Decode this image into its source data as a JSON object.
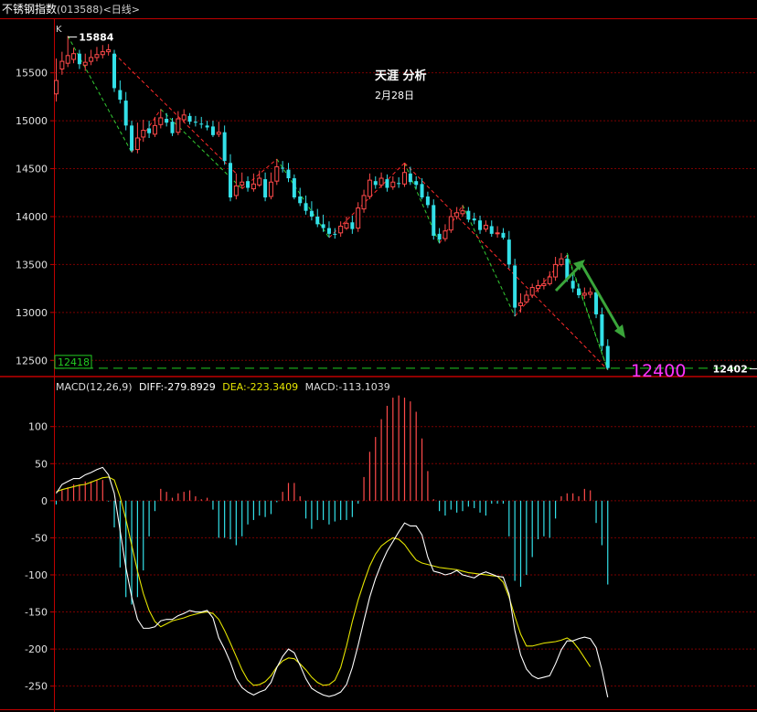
{
  "window": {
    "title": "不锈钢指数",
    "code": "(013588)",
    "period": "<日线>"
  },
  "colors": {
    "up": "#ff4a4a",
    "down": "#33e0e8",
    "grid": "#7a0000",
    "frame": "#c00000",
    "diff": "#ffffff",
    "dea": "#e5e500",
    "zig_green": "#33cc33",
    "zig_red": "#ff2b2b",
    "support": "#22cc22",
    "target_text": "#ff33ff",
    "arrow": "#3aa53a"
  },
  "chart_data": [
    {
      "type": "candlestick",
      "panel_label": "K",
      "title": "天涯 分析",
      "subtitle": "2月28日",
      "ylim": [
        12350,
        16050
      ],
      "yticks": [
        12500,
        13000,
        13500,
        14000,
        14500,
        15000,
        15500
      ],
      "grid": true,
      "high_marker": {
        "label": "15884",
        "index": 2,
        "value": 15884
      },
      "low_marker": {
        "label": "12402",
        "index": 121,
        "value": 12402
      },
      "support_line": {
        "value": 12418,
        "label": "12418"
      },
      "target_annotation": {
        "text": "12400",
        "value": 12400
      },
      "closes": [
        15420,
        15620,
        15680,
        15700,
        15590,
        15610,
        15660,
        15690,
        15720,
        15740,
        15340,
        15220,
        14950,
        14690,
        14820,
        14900,
        14870,
        14950,
        15030,
        14980,
        14870,
        15020,
        15060,
        14990,
        14980,
        14960,
        14930,
        14850,
        14880,
        14580,
        14200,
        14320,
        14360,
        14300,
        14340,
        14400,
        14200,
        14360,
        14520,
        14500,
        14400,
        14200,
        14140,
        14060,
        14000,
        13920,
        13880,
        13820,
        13810,
        13900,
        13930,
        13870,
        14090,
        14220,
        14380,
        14330,
        14400,
        14300,
        14360,
        14340,
        14460,
        14360,
        14330,
        14200,
        14120,
        13800,
        13760,
        13850,
        14000,
        14040,
        14060,
        13970,
        13960,
        13860,
        13910,
        13820,
        13830,
        13780,
        13500,
        13050,
        13100,
        13180,
        13260,
        13280,
        13300,
        13370,
        13500,
        13560,
        13350,
        13250,
        13180,
        13200,
        13210,
        12980,
        12650,
        12420
      ],
      "opens": [
        15280,
        15540,
        15600,
        15640,
        15700,
        15580,
        15620,
        15660,
        15690,
        15720,
        15700,
        15320,
        15210,
        14950,
        14700,
        14830,
        14920,
        14860,
        14960,
        15020,
        14990,
        14880,
        15010,
        15050,
        14990,
        14970,
        14950,
        14940,
        14860,
        14880,
        14560,
        14220,
        14330,
        14370,
        14290,
        14330,
        14390,
        14210,
        14370,
        14510,
        14490,
        14400,
        14210,
        14140,
        14060,
        14000,
        13920,
        13880,
        13820,
        13830,
        13880,
        13940,
        13880,
        14080,
        14210,
        14370,
        14330,
        14390,
        14310,
        14350,
        14340,
        14450,
        14370,
        14340,
        14210,
        14120,
        13820,
        13770,
        13860,
        14000,
        14030,
        14060,
        13980,
        13960,
        13870,
        13900,
        13830,
        13830,
        13760,
        13490,
        13070,
        13110,
        13180,
        13250,
        13280,
        13300,
        13370,
        13500,
        13560,
        13330,
        13250,
        13180,
        13190,
        13210,
        12980,
        12650
      ],
      "highs": [
        15650,
        15720,
        15884,
        15760,
        15740,
        15700,
        15740,
        15770,
        15790,
        15800,
        15740,
        15420,
        15300,
        15000,
        14980,
        15010,
        15000,
        15040,
        15120,
        15080,
        15030,
        15100,
        15120,
        15080,
        15050,
        15040,
        15000,
        15000,
        14990,
        14950,
        14650,
        14450,
        14460,
        14420,
        14450,
        14480,
        14460,
        14460,
        14600,
        14580,
        14560,
        14440,
        14300,
        14220,
        14160,
        14080,
        14020,
        13950,
        13880,
        13950,
        14000,
        14010,
        14150,
        14280,
        14450,
        14420,
        14460,
        14440,
        14420,
        14410,
        14560,
        14520,
        14420,
        14400,
        14260,
        14180,
        13880,
        13920,
        14060,
        14100,
        14120,
        14100,
        14040,
        14010,
        13960,
        13960,
        13900,
        13880,
        13850,
        13560,
        13200,
        13230,
        13300,
        13340,
        13360,
        13430,
        13580,
        13620,
        13600,
        13400,
        13300,
        13260,
        13260,
        13250,
        13050,
        12720
      ],
      "lows": [
        15200,
        15480,
        15560,
        15600,
        15540,
        15520,
        15580,
        15620,
        15650,
        15680,
        15300,
        15180,
        14900,
        14670,
        14660,
        14780,
        14820,
        14830,
        14920,
        14940,
        14840,
        14850,
        14980,
        14960,
        14940,
        14920,
        14900,
        14830,
        14830,
        14540,
        14160,
        14180,
        14290,
        14260,
        14260,
        14310,
        14160,
        14180,
        14330,
        14460,
        14360,
        14180,
        14110,
        14020,
        13960,
        13890,
        13840,
        13780,
        13770,
        13790,
        13860,
        13820,
        13840,
        14040,
        14180,
        14290,
        14300,
        14260,
        14280,
        14300,
        14310,
        14330,
        14290,
        14180,
        14090,
        13760,
        13720,
        13740,
        13830,
        13970,
        14000,
        13940,
        13920,
        13820,
        13840,
        13790,
        13780,
        13760,
        13460,
        12960,
        13000,
        13090,
        13150,
        13210,
        13240,
        13280,
        13330,
        13480,
        13320,
        13210,
        13150,
        13140,
        13150,
        12940,
        12600,
        12402
      ]
    },
    {
      "type": "line",
      "panel_label": "MACD(12,26,9)",
      "ylim": [
        -280,
        165
      ],
      "yticks": [
        -250,
        -200,
        -150,
        -100,
        -50,
        0,
        50,
        100
      ],
      "grid": true,
      "indicators": [
        {
          "name": "DIFF",
          "value_label": "DIFF:-279.8929"
        },
        {
          "name": "DEA",
          "value_label": "DEA:-223.3409"
        },
        {
          "name": "MACD",
          "value_label": "MACD:-113.1039"
        }
      ],
      "series": [
        {
          "name": "DIFF",
          "values": [
            10,
            22,
            26,
            30,
            30,
            35,
            38,
            42,
            45,
            35,
            10,
            -40,
            -90,
            -130,
            -160,
            -172,
            -172,
            -170,
            -162,
            -160,
            -160,
            -155,
            -152,
            -148,
            -150,
            -150,
            -148,
            -158,
            -185,
            -200,
            -218,
            -240,
            -252,
            -258,
            -262,
            -258,
            -255,
            -245,
            -225,
            -210,
            -200,
            -205,
            -222,
            -240,
            -253,
            -258,
            -262,
            -264,
            -262,
            -258,
            -248,
            -225,
            -195,
            -162,
            -130,
            -105,
            -85,
            -68,
            -55,
            -42,
            -30,
            -34,
            -34,
            -46,
            -76,
            -95,
            -97,
            -100,
            -98,
            -94,
            -100,
            -102,
            -104,
            -99,
            -96,
            -99,
            -102,
            -103,
            -126,
            -175,
            -208,
            -227,
            -236,
            -240,
            -238,
            -236,
            -220,
            -201,
            -189,
            -189,
            -186,
            -184,
            -186,
            -198,
            -228,
            -265
          ]
        },
        {
          "name": "DEA",
          "values": [
            12,
            15,
            17,
            19,
            21,
            22,
            25,
            28,
            31,
            32,
            28,
            5,
            -25,
            -60,
            -95,
            -125,
            -148,
            -163,
            -170,
            -166,
            -162,
            -160,
            -158,
            -155,
            -153,
            -151,
            -150,
            -152,
            -160,
            -175,
            -192,
            -210,
            -228,
            -242,
            -249,
            -248,
            -244,
            -236,
            -224,
            -216,
            -212,
            -213,
            -220,
            -228,
            -238,
            -245,
            -249,
            -248,
            -242,
            -225,
            -196,
            -163,
            -134,
            -110,
            -88,
            -72,
            -61,
            -55,
            -50,
            -52,
            -59,
            -70,
            -80,
            -84,
            -86,
            -88,
            -90,
            -91,
            -92,
            -93,
            -95,
            -97,
            -98,
            -99,
            -100,
            -101,
            -102,
            -110,
            -130,
            -156,
            -180,
            -196,
            -196,
            -194,
            -192,
            -191,
            -190,
            -188,
            -185,
            -190,
            -200,
            -212,
            -224
          ]
        },
        {
          "name": "MACD",
          "values": [
            -5,
            14,
            18,
            22,
            22,
            26,
            26,
            28,
            28,
            -1,
            -36,
            -90,
            -130,
            -140,
            -130,
            -94,
            -48,
            -14,
            16,
            12,
            4,
            10,
            12,
            14,
            6,
            2,
            4,
            -12,
            -50,
            -50,
            -52,
            -60,
            -48,
            -32,
            -26,
            -20,
            -22,
            -18,
            -2,
            12,
            24,
            24,
            6,
            -24,
            -38,
            -26,
            -26,
            -32,
            -28,
            -26,
            -26,
            -22,
            -4,
            32,
            66,
            86,
            110,
            128,
            139,
            142,
            139,
            134,
            120,
            84,
            40,
            2,
            -14,
            -20,
            -12,
            -16,
            -14,
            -8,
            -10,
            -16,
            -20,
            -4,
            -4,
            -4,
            -48,
            -108,
            -116,
            -100,
            -76,
            -52,
            -48,
            -50,
            -24,
            6,
            10,
            10,
            6,
            16,
            14,
            -30,
            -60,
            -113
          ]
        }
      ]
    }
  ]
}
